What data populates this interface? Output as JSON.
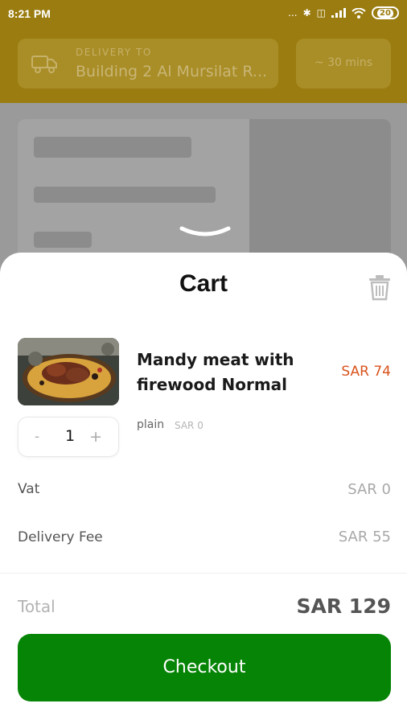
{
  "status_bar": {
    "time": "8:21 PM",
    "signal_dots": "...",
    "battery_level": "20"
  },
  "header": {
    "delivery_label": "DELIVERY TO",
    "delivery_address": "Building 2 Al Mursilat R...",
    "eta": "~ 30 mins"
  },
  "cart": {
    "title": "Cart",
    "item": {
      "name": "Mandy meat with firewood Normal",
      "price": "SAR 74",
      "quantity": "1",
      "qty_minus": "-",
      "qty_plus": "+",
      "option_name": "plain",
      "option_price": "SAR 0"
    },
    "vat_label": "Vat",
    "vat_value": "SAR 0",
    "delivery_fee_label": "Delivery Fee",
    "delivery_fee_value": "SAR 55",
    "total_label": "Total",
    "total_value": "SAR 129",
    "checkout_label": "Checkout"
  },
  "colors": {
    "brand_header": "#9a7c10",
    "price_accent": "#d9531e",
    "checkout_green": "#068406"
  }
}
